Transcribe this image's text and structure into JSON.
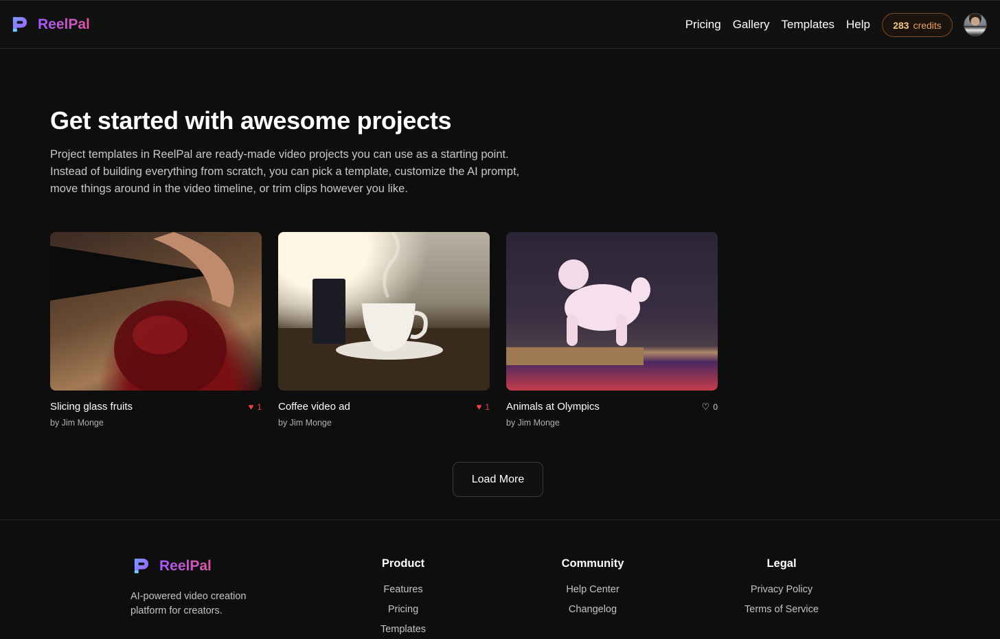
{
  "nav": {
    "brand": "ReelPal",
    "links": [
      "Pricing",
      "Gallery",
      "Templates",
      "Help"
    ],
    "credits_count": "283",
    "credits_label": "credits"
  },
  "hero": {
    "title": "Get started with awesome projects",
    "description": "Project templates in ReelPal are ready-made video projects you can use as a starting point. Instead of building everything from scratch, you can pick a template, customize the AI prompt, move things around in the video timeline, or trim clips however you like."
  },
  "templates": [
    {
      "title": "Slicing glass fruits",
      "author": "by Jim Monge",
      "likes": "1",
      "liked": true
    },
    {
      "title": "Coffee video ad",
      "author": "by Jim Monge",
      "likes": "1",
      "liked": true
    },
    {
      "title": "Animals at Olympics",
      "author": "by Jim Monge",
      "likes": "0",
      "liked": false
    }
  ],
  "load_more": "Load More",
  "footer": {
    "brand": "ReelPal",
    "tagline": "AI-powered video creation platform for creators.",
    "columns": [
      {
        "heading": "Product",
        "links": [
          "Features",
          "Pricing",
          "Templates"
        ]
      },
      {
        "heading": "Community",
        "links": [
          "Help Center",
          "Changelog"
        ]
      },
      {
        "heading": "Legal",
        "links": [
          "Privacy Policy",
          "Terms of Service"
        ]
      }
    ]
  },
  "colors": {
    "background": "#0e0e0e",
    "brand_gradient_start": "#a35bff",
    "brand_gradient_end": "#e0559f",
    "credits_accent": "#e9a060",
    "like_red": "#ef4444"
  },
  "icons": {
    "logo": "reelpal-logo-icon",
    "like_filled": "heart-filled-icon",
    "like_outline": "heart-outline-icon"
  }
}
